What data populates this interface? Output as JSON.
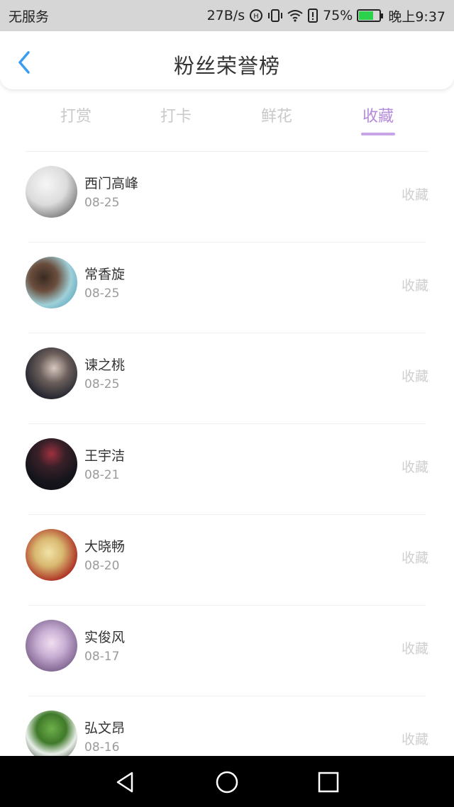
{
  "status_bar": {
    "carrier": "无服务",
    "speed": "27B/s",
    "battery_percent": "75%",
    "time": "晚上9:37",
    "battery_level": 0.75,
    "battery_color": "#2bd14a"
  },
  "header": {
    "title": "粉丝荣誉榜",
    "back_icon": "chevron-left-icon"
  },
  "tabs": [
    {
      "label": "打赏",
      "active": false
    },
    {
      "label": "打卡",
      "active": false
    },
    {
      "label": "鲜花",
      "active": false
    },
    {
      "label": "收藏",
      "active": true
    }
  ],
  "accent_color": "#b48adb",
  "fans": [
    {
      "name": "西门高峰",
      "date": "08-25",
      "action": "收藏"
    },
    {
      "name": "常香旋",
      "date": "08-25",
      "action": "收藏"
    },
    {
      "name": "谏之桃",
      "date": "08-25",
      "action": "收藏"
    },
    {
      "name": "王宇洁",
      "date": "08-21",
      "action": "收藏"
    },
    {
      "name": "大晓畅",
      "date": "08-20",
      "action": "收藏"
    },
    {
      "name": "实俊风",
      "date": "08-17",
      "action": "收藏"
    },
    {
      "name": "弘文昂",
      "date": "08-16",
      "action": "收藏"
    }
  ],
  "system_nav": {
    "back": "triangle-back-icon",
    "home": "circle-home-icon",
    "recents": "square-recents-icon"
  }
}
